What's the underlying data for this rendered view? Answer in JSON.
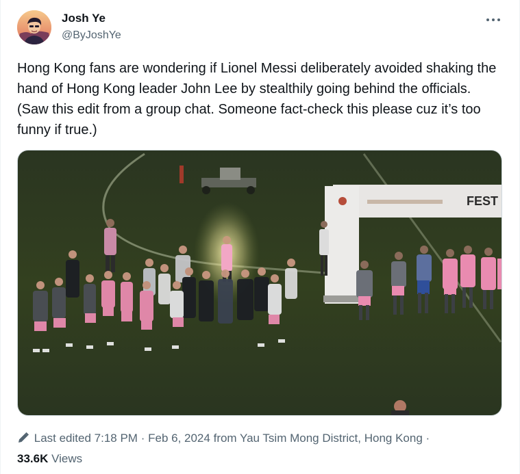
{
  "author": {
    "name": "Josh Ye",
    "handle": "@ByJoshYe",
    "avatar_icon": "avatar-illustration"
  },
  "more_icon": "more-horizontal-icon",
  "tweet": {
    "text": "Hong Kong fans are wondering if Lionel Messi deliberately avoided shaking the hand of Hong Kong leader John Lee by stealthily going behind the officials. (Saw this edit from a group chat. Someone fact-check this please cuz it’s too funny if true.)"
  },
  "media": {
    "banner_text": "FEST"
  },
  "footer": {
    "edit_icon": "pencil-icon",
    "last_edited_label": "Last edited",
    "time": "7:18 PM",
    "separator": "·",
    "date": "Feb 6, 2024",
    "from_label": "from",
    "location": "Yau Tsim Mong District, Hong Kong",
    "views_count": "33.6K",
    "views_label": "Views"
  },
  "colors": {
    "text_primary": "#0f1419",
    "text_secondary": "#536471",
    "border": "#cfd9de",
    "pitch": "#2f3b1f",
    "team_kit_pink": "#f08cb4",
    "spotlight": "#fff7b0"
  }
}
